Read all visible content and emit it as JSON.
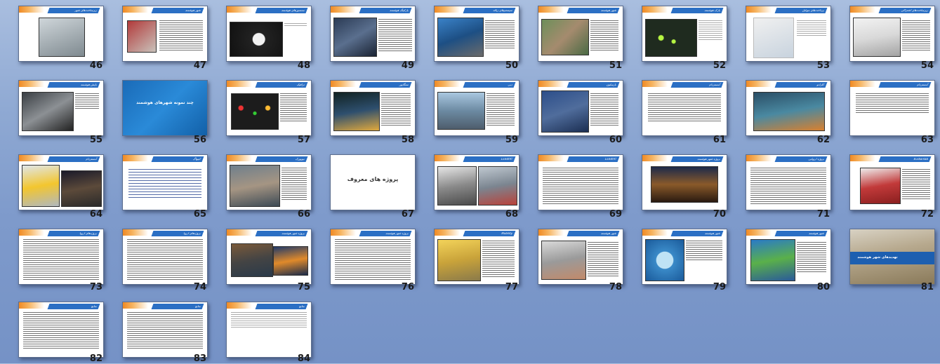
{
  "slides": [
    {
      "num": "46",
      "title": "زیرساخت‌های شهر"
    },
    {
      "num": "47",
      "title": "شهر هوشمند"
    },
    {
      "num": "48",
      "title": "سنسورهای هوشمند"
    },
    {
      "num": "49",
      "title": "پارکینگ هوشمند"
    },
    {
      "num": "50",
      "title": "سیستم‌های زباله"
    },
    {
      "num": "51",
      "title": "شهر هوشمند"
    },
    {
      "num": "52",
      "title": "پارک هوشمند"
    },
    {
      "num": "53",
      "title": "پرداخت‌های موبایل"
    },
    {
      "num": "54",
      "title": "زیرساخت‌های اشتراکی"
    },
    {
      "num": "55",
      "title": "پایش هوشمند"
    },
    {
      "num": "56",
      "title": "چند نمونه شهرهای هوشمند"
    },
    {
      "num": "57",
      "title": "ترافیک"
    },
    {
      "num": "58",
      "title": "سنگاپور"
    },
    {
      "num": "59",
      "title": "دبی"
    },
    {
      "num": "60",
      "title": "بارسلون"
    },
    {
      "num": "61",
      "title": "آمستردام"
    },
    {
      "num": "62",
      "title": "کلرادو"
    },
    {
      "num": "63",
      "title": "آمستردام"
    },
    {
      "num": "64",
      "title": "آمستردام"
    },
    {
      "num": "65",
      "title": "کپنهاگ"
    },
    {
      "num": "66",
      "title": "نیویورک"
    },
    {
      "num": "67",
      "title": "پروژه های معروف"
    },
    {
      "num": "68",
      "title": "LinkNYC"
    },
    {
      "num": "69",
      "title": "LinkNYC"
    },
    {
      "num": "70",
      "title": "پروژه شهر هوشمند"
    },
    {
      "num": "71",
      "title": "پروژه اروپایی"
    },
    {
      "num": "72",
      "title": "Eurbanlab"
    },
    {
      "num": "73",
      "title": "پروژه‌های اروپا"
    },
    {
      "num": "74",
      "title": "پروژه‌های اروپا"
    },
    {
      "num": "75",
      "title": "پروژه شهر هوشمند"
    },
    {
      "num": "76",
      "title": "پروژه شهر هوشمند"
    },
    {
      "num": "77",
      "title": "Mobility"
    },
    {
      "num": "78",
      "title": "شهر هوشمند"
    },
    {
      "num": "79",
      "title": "شهر هوشمند"
    },
    {
      "num": "80",
      "title": "شهر هوشمند"
    },
    {
      "num": "81",
      "title": "تهدیدهای شهر هوشمند"
    },
    {
      "num": "82",
      "title": "منابع"
    },
    {
      "num": "83",
      "title": "منابع"
    },
    {
      "num": "84",
      "title": "منابع"
    }
  ],
  "labels": {
    "slide56_title": "چند نمونه شهرهای هوشمند",
    "slide67_title": "پروژه های معروف",
    "slide81_title": "تهدیدهای شهر هوشمند"
  }
}
